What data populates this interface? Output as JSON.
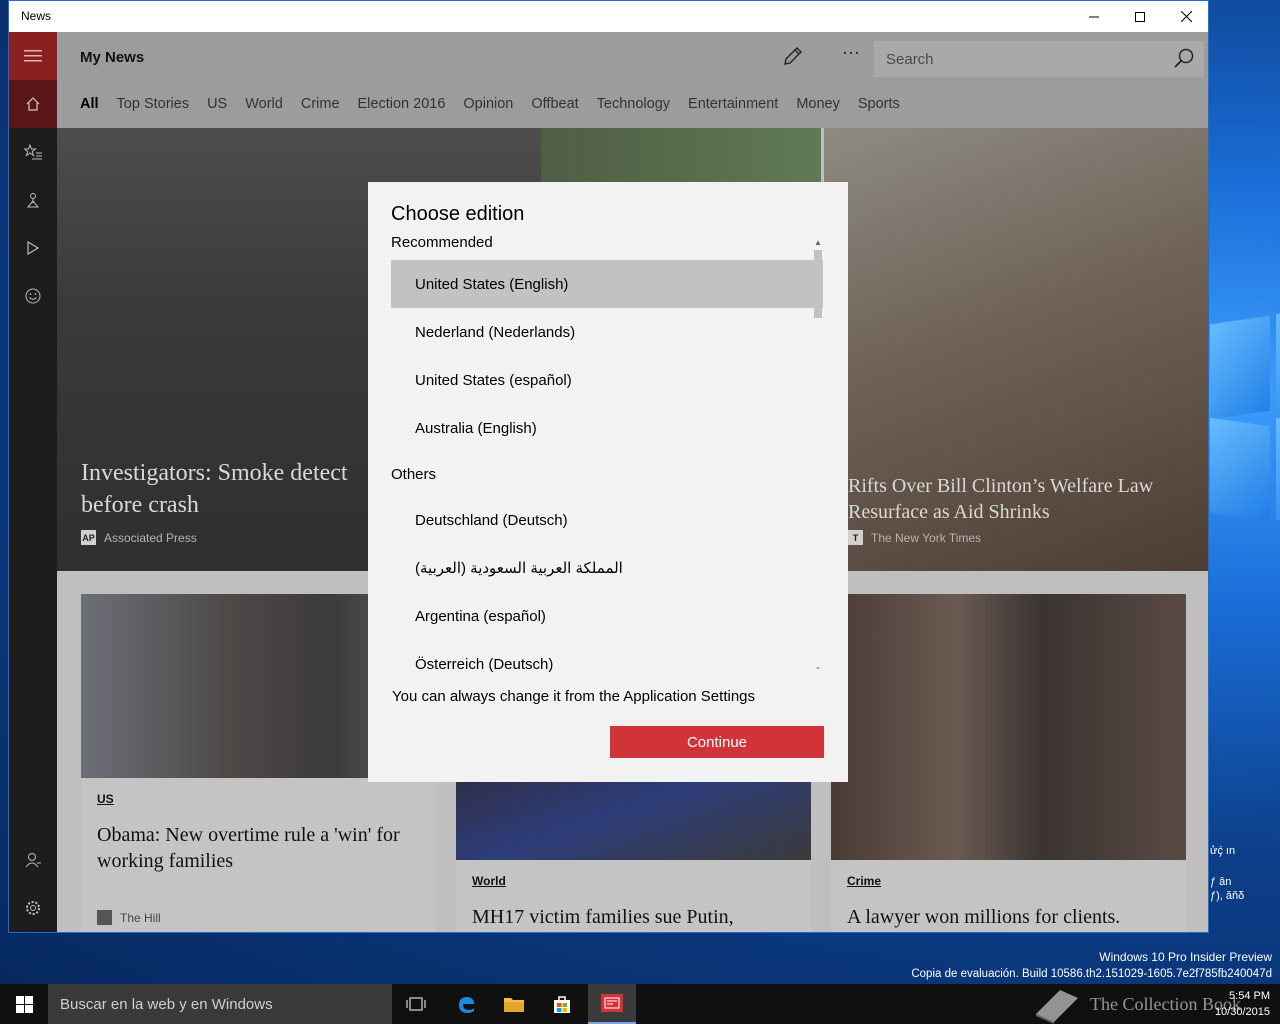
{
  "window": {
    "title": "News"
  },
  "header": {
    "title": "My News",
    "search_placeholder": "Search",
    "more_glyph": "···",
    "tabs": [
      "All",
      "Top Stories",
      "US",
      "World",
      "Crime",
      "Election 2016",
      "Opinion",
      "Offbeat",
      "Technology",
      "Entertainment",
      "Money",
      "Sports"
    ]
  },
  "hero": [
    {
      "title_line1": "Investigators: Smoke detect",
      "title_line2": "before crash",
      "source": "Associated Press",
      "logo": "AP"
    },
    {
      "title_line1": "Rifts Over Bill Clinton’s Welfare Law",
      "title_line2": "Resurface as Aid Shrinks",
      "source": "The New York Times",
      "logo": "T"
    }
  ],
  "cards": [
    {
      "tag": "US",
      "title": "Obama: New overtime rule a 'win' for working families",
      "source": "The Hill"
    },
    {
      "tag": "World",
      "title": "MH17 victim families sue Putin,",
      "source": ""
    },
    {
      "tag": "Crime",
      "title": "A lawyer won millions for clients.",
      "source": ""
    }
  ],
  "dialog": {
    "title": "Choose edition",
    "recommended_label": "Recommended",
    "others_label": "Others",
    "recommended": [
      "United States (English)",
      "Nederland (Nederlands)",
      "United States (español)",
      "Australia (English)"
    ],
    "others": [
      "Deutschland (Deutsch)",
      "المملكة العربية السعودية (العربية)",
      "Argentina (español)",
      "Österreich (Deutsch)"
    ],
    "note": "You can always change it from the Application Settings",
    "continue_label": "Continue"
  },
  "desktop": {
    "edition_line1": "Windows 10 Pro Insider Preview",
    "edition_line2": "Copia de evaluación. Build 10586.th2.151029-1605.7e2f785fb240047d",
    "side_text1": "ửḉ ın",
    "side_text2": "ƒ ân",
    "side_text3": "ƒ), ăñδ"
  },
  "taskbar": {
    "search_placeholder": "Buscar en la web y en Windows",
    "time": "5:54 PM",
    "date": "10/30/2015",
    "watermark": "The Collection Book"
  },
  "colors": {
    "accent": "#d13438",
    "rail": "#1d1d1d",
    "hamburger": "#8b2020",
    "selected": "#c2c2c2"
  }
}
